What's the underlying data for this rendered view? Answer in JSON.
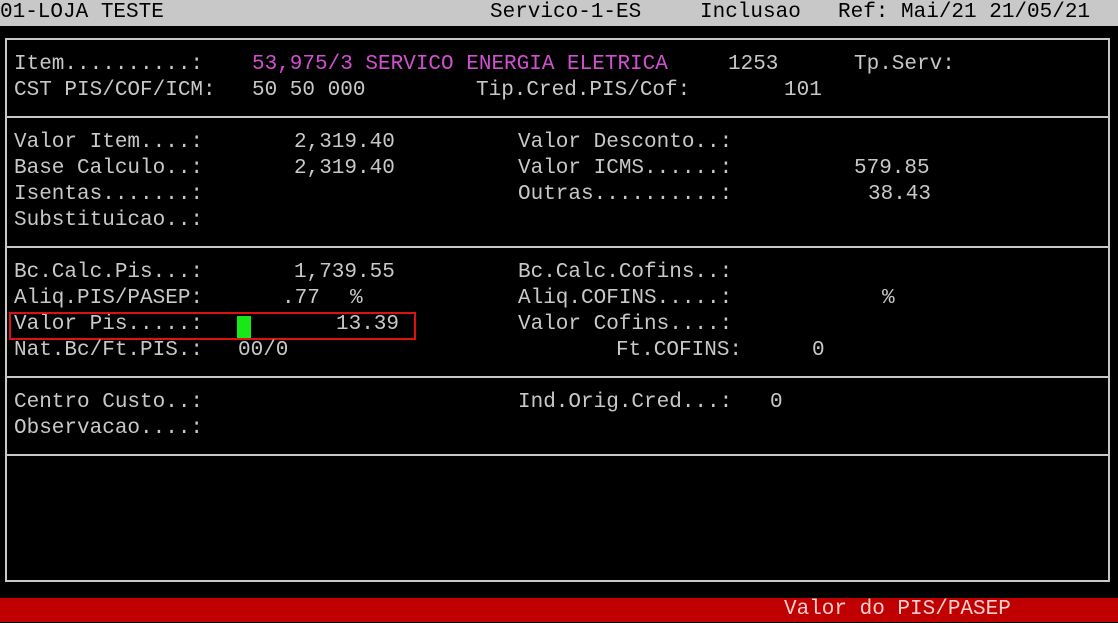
{
  "header": {
    "company": "01-LOJA TESTE",
    "module": "Servico-1-ES",
    "mode": "Inclusao",
    "ref": "Ref: Mai/21 21/05/21"
  },
  "item": {
    "label": "Item..........:",
    "code": "53,975/3 SERVICO ENERGIA ELETRICA",
    "number": "1253",
    "tpserv_label": "Tp.Serv:",
    "cst_label": "CST PIS/COF/ICM:",
    "cst_value": "50 50 000",
    "tipcred_label": "Tip.Cred.PIS/Cof:",
    "tipcred_value": "101"
  },
  "values": {
    "valor_item_label": "Valor Item....:",
    "valor_item": "2,319.40",
    "base_label": "Base Calculo..:",
    "base": "2,319.40",
    "isentas_label": "Isentas.......:",
    "subst_label": "Substituicao..:",
    "desconto_label": "Valor Desconto..:",
    "icms_label": "Valor ICMS......:",
    "icms": "579.85",
    "outras_label": "Outras..........:",
    "outras": "38.43"
  },
  "taxes": {
    "bc_pis_label": "Bc.Calc.Pis...:",
    "bc_pis": "1,739.55",
    "aliq_pis_label": "Aliq.PIS/PASEP:",
    "aliq_pis": ".77",
    "pct": "%",
    "valor_pis_label": "Valor Pis.....:",
    "valor_pis": "13.39",
    "nat_label": "Nat.Bc/Ft.PIS.:",
    "nat_value": "00/0",
    "bc_cofins_label": "Bc.Calc.Cofins..:",
    "aliq_cofins_label": "Aliq.COFINS.....:",
    "valor_cofins_label": "Valor Cofins....:",
    "ft_cofins_label": "Ft.COFINS:",
    "ft_cofins": "0"
  },
  "misc": {
    "centro_label": "Centro Custo..:",
    "obs_label": "Observacao....:",
    "ind_label": "Ind.Orig.Cred...:",
    "ind_value": "0"
  },
  "status": {
    "message": "Valor do PIS/PASEP"
  },
  "colors": {
    "highlight": "#d24fd2",
    "cursor": "#18e818",
    "focus_border": "#e01010",
    "status_bg": "#c00000"
  }
}
